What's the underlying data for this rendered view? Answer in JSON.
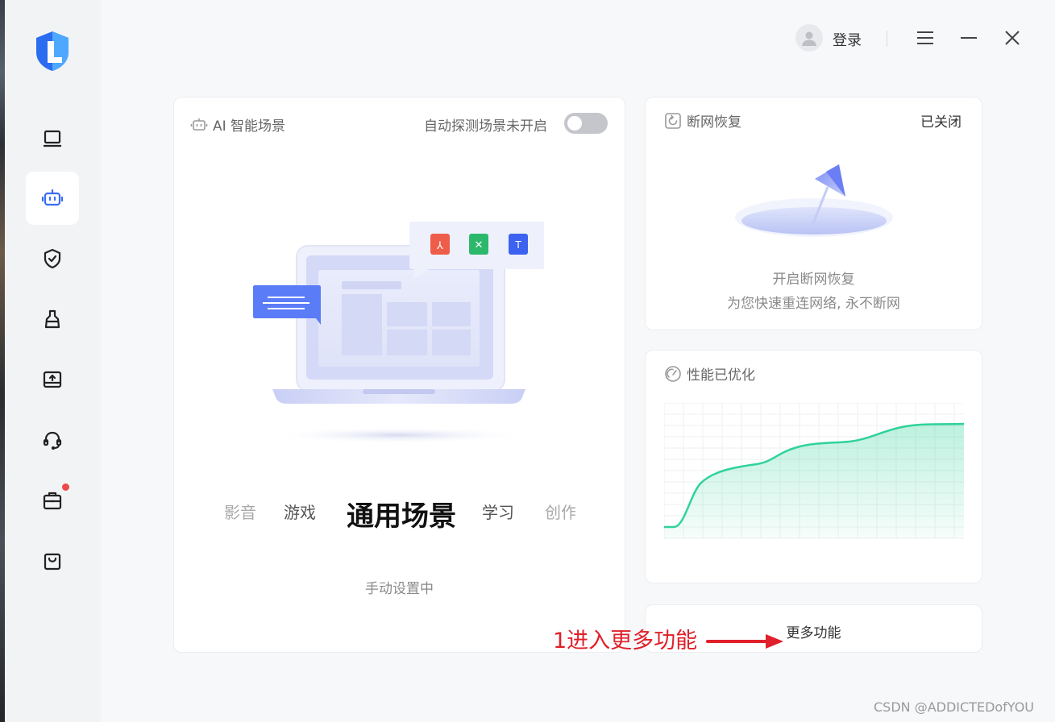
{
  "topbar": {
    "login_label": "登录",
    "icons": [
      "user-avatar-icon",
      "hamburger-menu-icon",
      "minimize-icon",
      "close-icon"
    ]
  },
  "sidebar": {
    "items": [
      {
        "icon": "laptop-icon",
        "active": false
      },
      {
        "icon": "robot-icon",
        "active": true
      },
      {
        "icon": "shield-check-icon",
        "active": false
      },
      {
        "icon": "broom-icon",
        "active": false
      },
      {
        "icon": "drive-upload-icon",
        "active": false
      },
      {
        "icon": "headset-icon",
        "active": false
      },
      {
        "icon": "toolbox-icon",
        "active": false,
        "badge": true
      },
      {
        "icon": "shopping-bag-icon",
        "active": false
      }
    ]
  },
  "ai_card": {
    "title": "AI 智能场景",
    "auto_detect_label": "自动探测场景未开启",
    "scenes": [
      "影音",
      "游戏",
      "通用场景",
      "学习",
      "创作"
    ],
    "selected_scene": "通用场景",
    "status": "手动设置中"
  },
  "network_card": {
    "title": "断网恢复",
    "status": "已关闭",
    "line1": "开启断网恢复",
    "line2": "为您快速重连网络, 永不断网"
  },
  "perf_card": {
    "title": "性能已优化"
  },
  "more_card": {
    "label": "更多功能"
  },
  "annotation": {
    "text": "1进入更多功能",
    "color": "#e0202a"
  },
  "watermark": "CSDN @ADDICTEDofYOU",
  "colors": {
    "accent": "#3b6cf6",
    "chart_line": "#2fd39a",
    "toggle_off": "#c4c6cc"
  }
}
